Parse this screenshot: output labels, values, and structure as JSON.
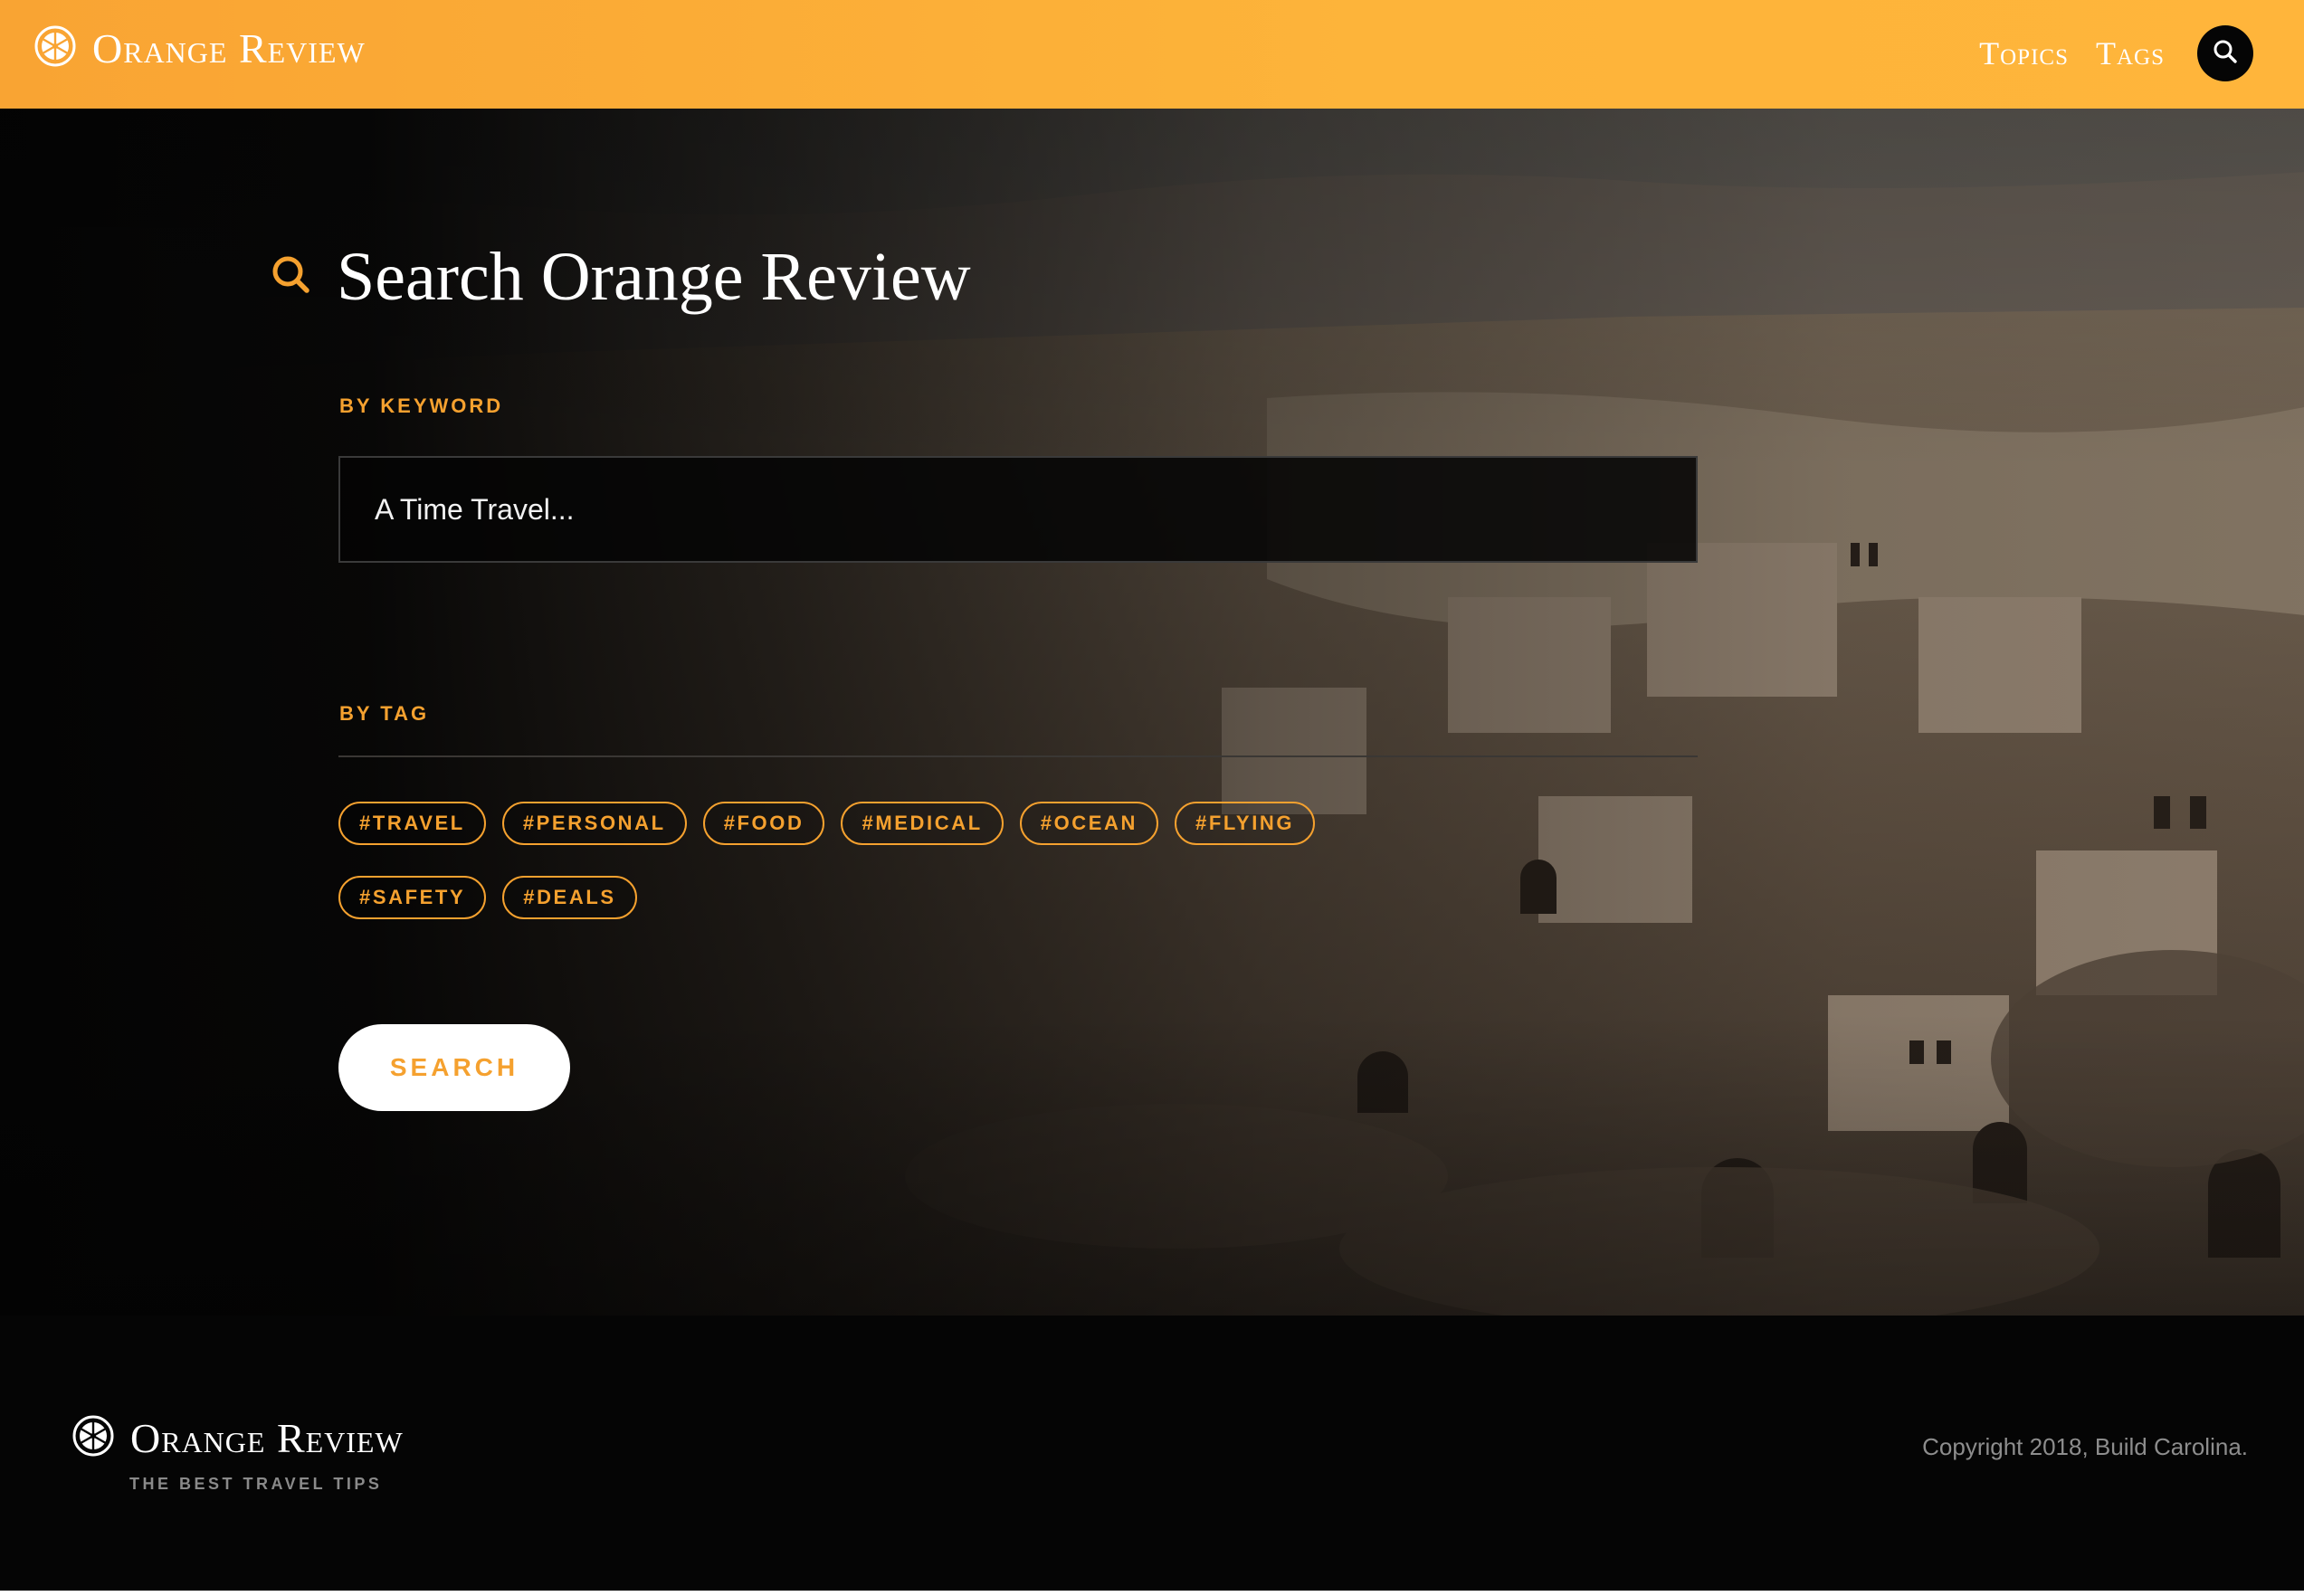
{
  "colors": {
    "accent": "#f5a12f",
    "header_start": "#f9a433",
    "header_end": "#ffb53b",
    "background": "#050505"
  },
  "header": {
    "brand": "Orange Review",
    "brand_icon": "orange-slice-icon",
    "nav": [
      {
        "label": "Topics"
      },
      {
        "label": "Tags"
      }
    ],
    "search_icon": "search-icon"
  },
  "search": {
    "title": "Search Orange Review",
    "title_icon": "search-icon",
    "keyword_label": "BY KEYWORD",
    "keyword_placeholder": "A Time Travel...",
    "tag_label": "BY TAG",
    "tags": [
      "#TRAVEL",
      "#PERSONAL",
      "#FOOD",
      "#MEDICAL",
      "#OCEAN",
      "#FLYING",
      "#SAFETY",
      "#DEALS"
    ],
    "button_label": "SEARCH"
  },
  "footer": {
    "brand": "Orange Review",
    "brand_icon": "orange-slice-icon",
    "tagline": "THE BEST TRAVEL TIPS",
    "copyright": "Copyright 2018, Build Carolina."
  }
}
